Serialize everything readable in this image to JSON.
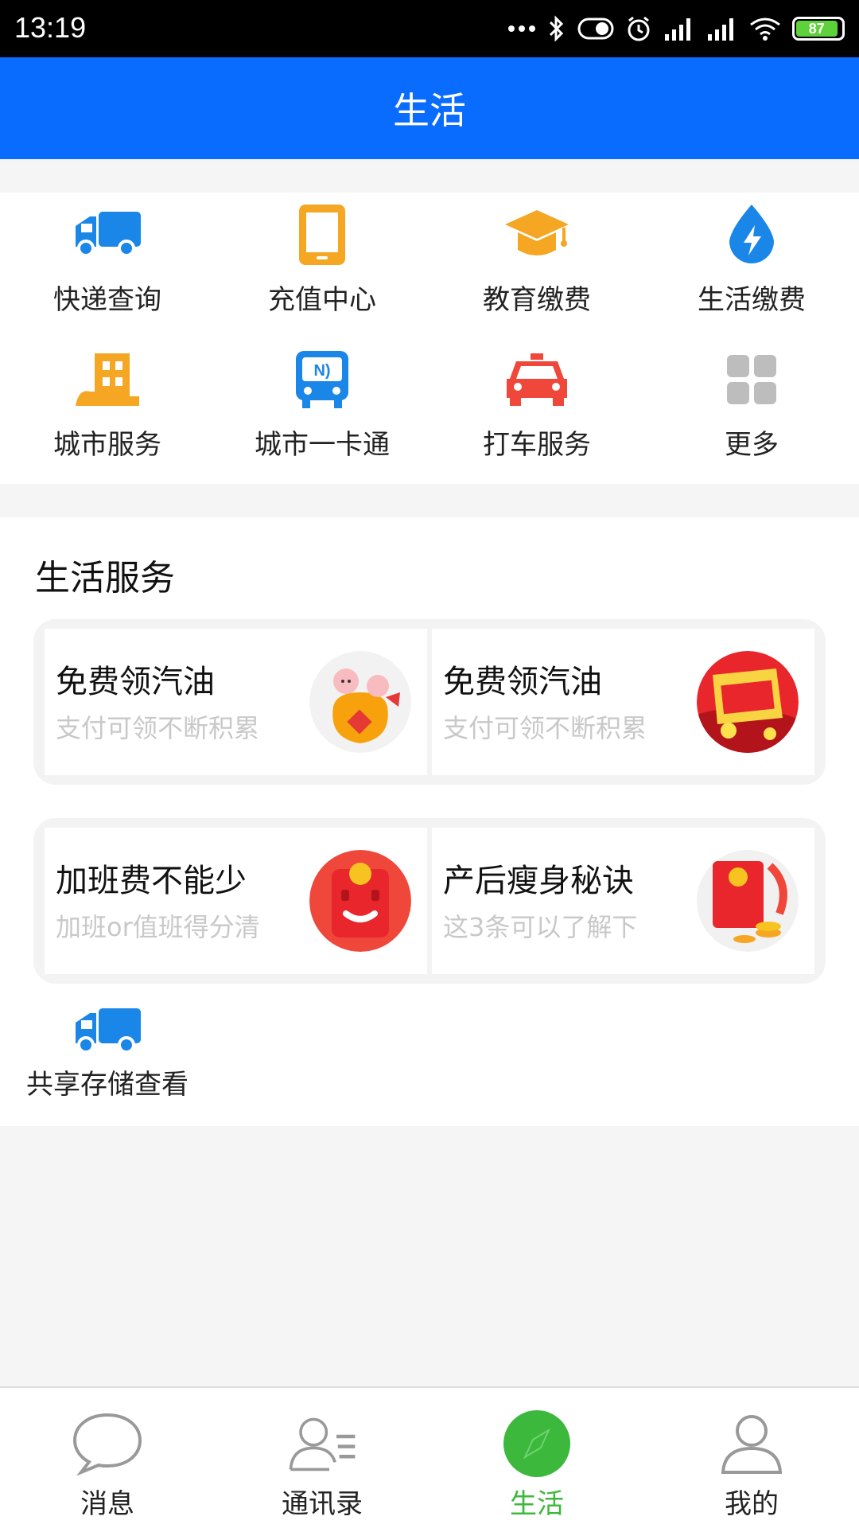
{
  "status_bar": {
    "time": "13:19",
    "battery": "87"
  },
  "header": {
    "title": "生活"
  },
  "grid": [
    {
      "label": "快递查询",
      "icon": "delivery-truck-icon"
    },
    {
      "label": "充值中心",
      "icon": "phone-icon"
    },
    {
      "label": "教育缴费",
      "icon": "graduation-cap-icon"
    },
    {
      "label": "生活缴费",
      "icon": "water-drop-bolt-icon"
    },
    {
      "label": "城市服务",
      "icon": "city-building-icon"
    },
    {
      "label": "城市一卡通",
      "icon": "bus-nfc-icon"
    },
    {
      "label": "打车服务",
      "icon": "taxi-icon"
    },
    {
      "label": "更多",
      "icon": "more-grid-icon"
    }
  ],
  "services": {
    "title": "生活服务",
    "rows": [
      [
        {
          "title": "免费领汽油",
          "subtitle": "支付可领不断积累"
        },
        {
          "title": "免费领汽油",
          "subtitle": "支付可领不断积累"
        }
      ],
      [
        {
          "title": "加班费不能少",
          "subtitle": "加班or值班得分清"
        },
        {
          "title": "产后瘦身秘诀",
          "subtitle": "这3条可以了解下"
        }
      ]
    ],
    "extra": {
      "label": "共享存储查看",
      "icon": "delivery-truck-icon"
    }
  },
  "tabs": [
    {
      "label": "消息",
      "icon": "chat-bubble-icon"
    },
    {
      "label": "通讯录",
      "icon": "contacts-icon"
    },
    {
      "label": "生活",
      "icon": "compass-icon",
      "active": true
    },
    {
      "label": "我的",
      "icon": "person-icon"
    }
  ],
  "colors": {
    "primary": "#0a6cff",
    "active_tab": "#3cb83c",
    "orange": "#f5a623",
    "red": "#f0473b",
    "blue": "#1a86e8"
  }
}
